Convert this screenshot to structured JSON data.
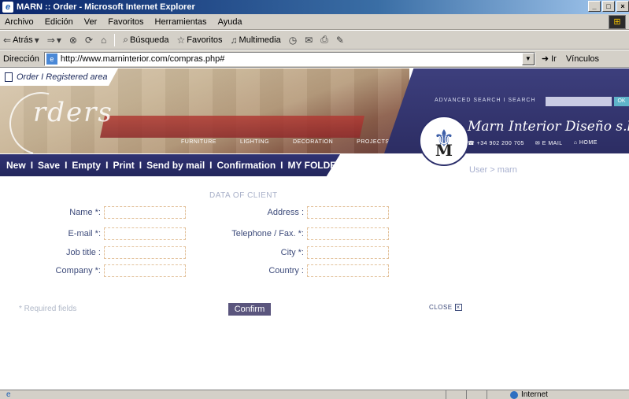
{
  "window": {
    "title": "MARN :: Order - Microsoft Internet Explorer",
    "controls": [
      "_",
      "□",
      "×"
    ]
  },
  "menu": [
    "Archivo",
    "Edición",
    "Ver",
    "Favoritos",
    "Herramientas",
    "Ayuda"
  ],
  "toolbar": {
    "back": "Atrás",
    "search": "Búsqueda",
    "favorites": "Favoritos",
    "multimedia": "Multimedia"
  },
  "address": {
    "label": "Dirección",
    "url": "http://www.marninterior.com/compras.php#",
    "go": "Ir",
    "links": "Vínculos"
  },
  "header": {
    "order_label": "Order I Registered area",
    "script_title": "rders",
    "nav": [
      "FURNITURE",
      "LIGHTING",
      "DECORATION",
      "PROJECTS"
    ],
    "search_links": "ADVANCED SEARCH I SEARCH",
    "search_ok": "OK",
    "brand": "Marn Interior Diseño s.l.",
    "phone": "+34 902 200 705",
    "email": "E MAIL",
    "home": "HOME",
    "logo_letter": "M"
  },
  "navbar": {
    "items": [
      "New",
      "Save",
      "Empty",
      "Print",
      "Send by mail",
      "Confirmation",
      "MY FOLDER"
    ]
  },
  "user_line": "User > marn",
  "form": {
    "section_title": "DATA OF CLIENT",
    "left_labels": [
      "Name *:",
      "E-mail *:",
      "Job title :",
      "Company *:"
    ],
    "right_labels": [
      "Address :",
      "Telephone / Fax. *:",
      "City *:",
      "Country :"
    ],
    "required_note": "* Required fields",
    "confirm": "Confirm",
    "close": "CLOSE"
  },
  "status": {
    "zone": "Internet"
  }
}
